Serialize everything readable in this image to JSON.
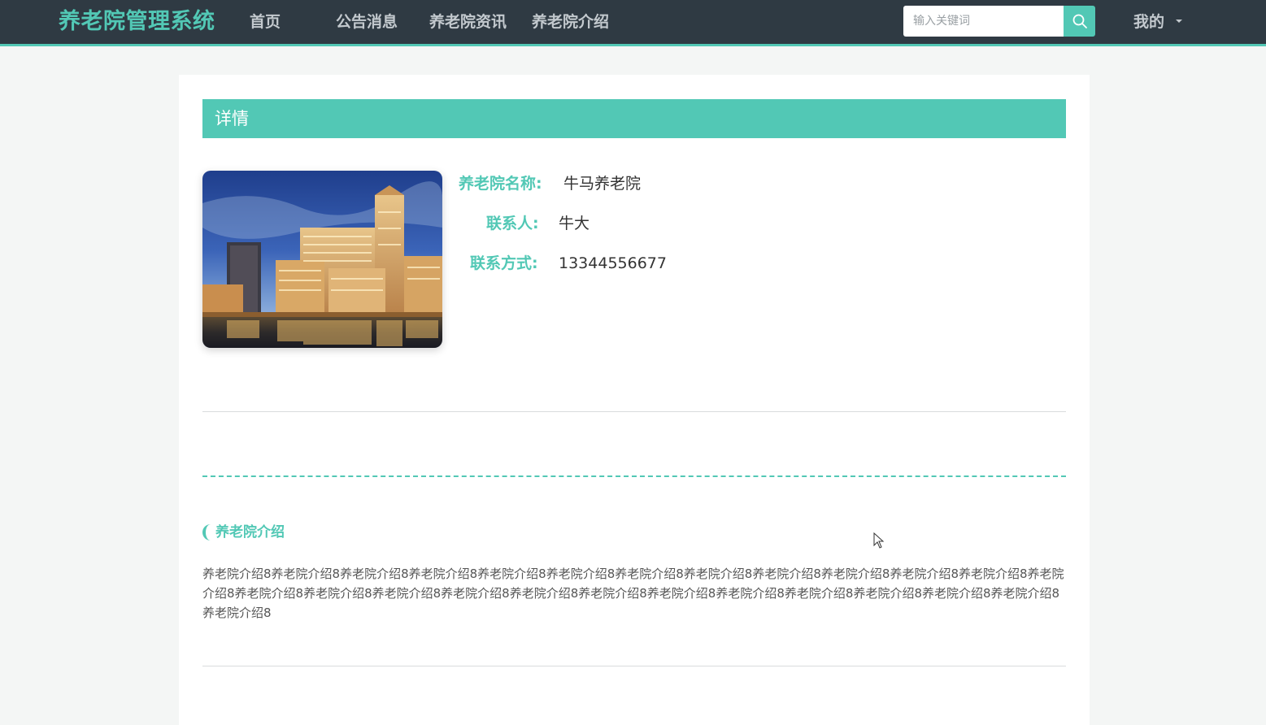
{
  "nav": {
    "brand": "养老院管理系统",
    "items": [
      {
        "label": "首页"
      },
      {
        "label": "公告消息"
      },
      {
        "label": "养老院资讯"
      },
      {
        "label": "养老院介绍"
      }
    ],
    "search": {
      "placeholder": "输入关键词",
      "value": ""
    },
    "user_menu": "我的"
  },
  "detail": {
    "header": "详情",
    "fields": [
      {
        "label": "养老院名称:",
        "value": "牛马养老院"
      },
      {
        "label": "联系人:",
        "value": "牛大"
      },
      {
        "label": "联系方式:",
        "value": "13344556677"
      }
    ]
  },
  "intro": {
    "title": "养老院介绍",
    "body": "养老院介绍8养老院介绍8养老院介绍8养老院介绍8养老院介绍8养老院介绍8养老院介绍8养老院介绍8养老院介绍8养老院介绍8养老院介绍8养老院介绍8养老院介绍8养老院介绍8养老院介绍8养老院介绍8养老院介绍8养老院介绍8养老院介绍8养老院介绍8养老院介绍8养老院介绍8养老院介绍8养老院介绍8养老院介绍8养老院介绍8"
  },
  "colors": {
    "accent": "#52c8b5",
    "nav_bg": "#2f3a43",
    "page_bg": "#f4f6f5"
  },
  "icons": {
    "search": "search-icon",
    "dropdown": "caret-down-icon"
  }
}
